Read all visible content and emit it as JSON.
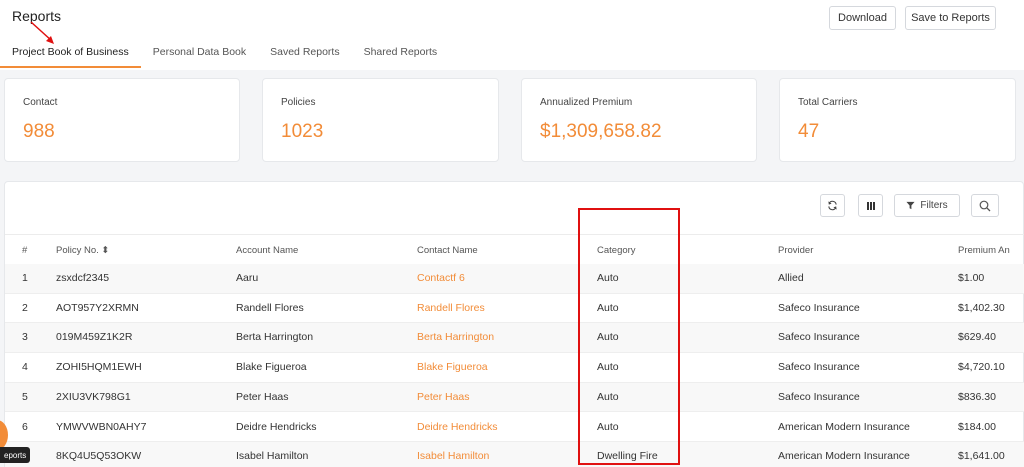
{
  "header": {
    "title": "Reports",
    "download_label": "Download",
    "save_label": "Save to Reports"
  },
  "tabs": [
    {
      "label": "Project Book of Business",
      "active": true
    },
    {
      "label": "Personal Data Book",
      "active": false
    },
    {
      "label": "Saved Reports",
      "active": false
    },
    {
      "label": "Shared Reports",
      "active": false
    }
  ],
  "summary": [
    {
      "label": "Contact",
      "value": "988"
    },
    {
      "label": "Policies",
      "value": "1023"
    },
    {
      "label": "Annualized Premium",
      "value": "$1,309,658.82"
    },
    {
      "label": "Total Carriers",
      "value": "47"
    }
  ],
  "toolbar": {
    "filters_label": "Filters"
  },
  "table": {
    "headers": [
      "#",
      "Policy No. ⬍",
      "Account Name",
      "Contact Name",
      "Category",
      "Provider",
      "Premium An"
    ],
    "rows": [
      [
        "1",
        "zsxdcf2345",
        "Aaru",
        "Contactf 6",
        "Auto",
        "Allied",
        "$1.00"
      ],
      [
        "2",
        "AOT957Y2XRMN",
        "Randell Flores",
        "Randell Flores",
        "Auto",
        "Safeco Insurance",
        "$1,402.30"
      ],
      [
        "3",
        "019M459Z1K2R",
        "Berta Harrington",
        "Berta Harrington",
        "Auto",
        "Safeco Insurance",
        "$629.40"
      ],
      [
        "4",
        "ZOHI5HQM1EWH",
        "Blake Figueroa",
        "Blake Figueroa",
        "Auto",
        "Safeco Insurance",
        "$4,720.10"
      ],
      [
        "5",
        "2XIU3VK798G1",
        "Peter Haas",
        "Peter Haas",
        "Auto",
        "Safeco Insurance",
        "$836.30"
      ],
      [
        "6",
        "YMWVWBN0AHY7",
        "Deidre Hendricks",
        "Deidre Hendricks",
        "Auto",
        "American Modern Insurance",
        "$184.00"
      ],
      [
        "",
        "8KQ4U5Q53OKW",
        "Isabel Hamilton",
        "Isabel Hamilton",
        "Dwelling Fire",
        "American Modern Insurance",
        "$1,641.00"
      ]
    ]
  },
  "tooltip": {
    "label": "eports"
  },
  "colors": {
    "accent": "#f28c38",
    "highlight": "#e01010"
  }
}
